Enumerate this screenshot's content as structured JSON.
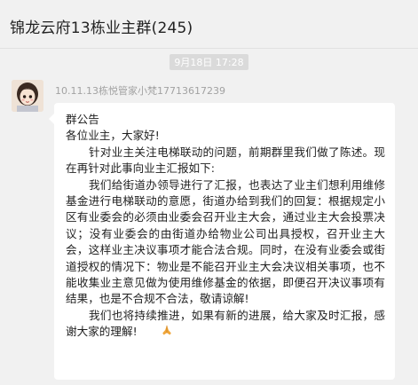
{
  "window": {
    "title": "锦龙云府13栋业主群(245)"
  },
  "chat": {
    "timestamp": "9月18日 17:28",
    "message": {
      "sender": "10.11.13栋悦管家小梵17713617239",
      "lines": [
        "群公告",
        "各位业主，大家好!",
        "针对业主关注电梯联动的问题，前期群里我们做了陈述。现在再针对此事向业主汇报如下:",
        "我们给街道办领导进行了汇报，也表达了业主们想利用维修基金进行电梯联动的意愿，街道办给到我们的回复：根据规定小区有业委会的必须由业委会召开业主大会，通过业主大会投票决议；没有业委会的由街道办给物业公司出具授权，召开业主大会，这样业主决议事项才能合法合规。同时，在没有业委会或街道授权的情况下：物业是不能召开业主大会决议相关事项，也不能收集业主意见做为使用维修基金的依据，即便召开决议事项有结果，也是不合规不合法，敬请谅解!",
        "我们也将持续推进，如果有新的进展，给大家及时汇报，感谢大家的理解!"
      ],
      "emoji": "pray-hands-emoji",
      "bubble_color": "#ffffff"
    }
  },
  "colors": {
    "background": "#f1f1f1",
    "meta_text": "#a2a2a2",
    "emoji": "#f0a63a"
  }
}
